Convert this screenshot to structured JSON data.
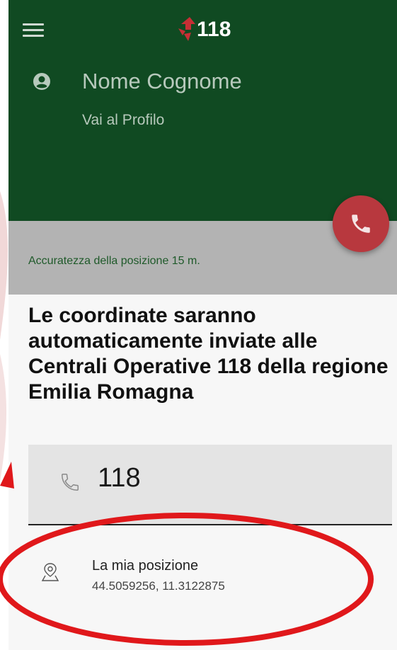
{
  "header": {
    "menu_icon": "hamburger-menu-icon",
    "logo_text": "118",
    "user_name": "Nome Cognome",
    "profile_link": "Vai al Profilo",
    "bg_color": "#104a22"
  },
  "location_info": {
    "accuracy_text": "Accuratezza della posizione 15 m."
  },
  "call_button": {
    "icon": "phone-icon",
    "color": "#b8383e"
  },
  "message": "Le coordinate saranno automaticamente inviate alle Centrali Operative 118 della regione Emilia Romagna",
  "phone_input": {
    "value": "118",
    "icon": "phone-outline-icon"
  },
  "position": {
    "title": "La mia posizione",
    "coordinates": "44.5059256, 11.3122875",
    "icon": "map-pin-icon"
  },
  "annotation_color": "#e0181b"
}
